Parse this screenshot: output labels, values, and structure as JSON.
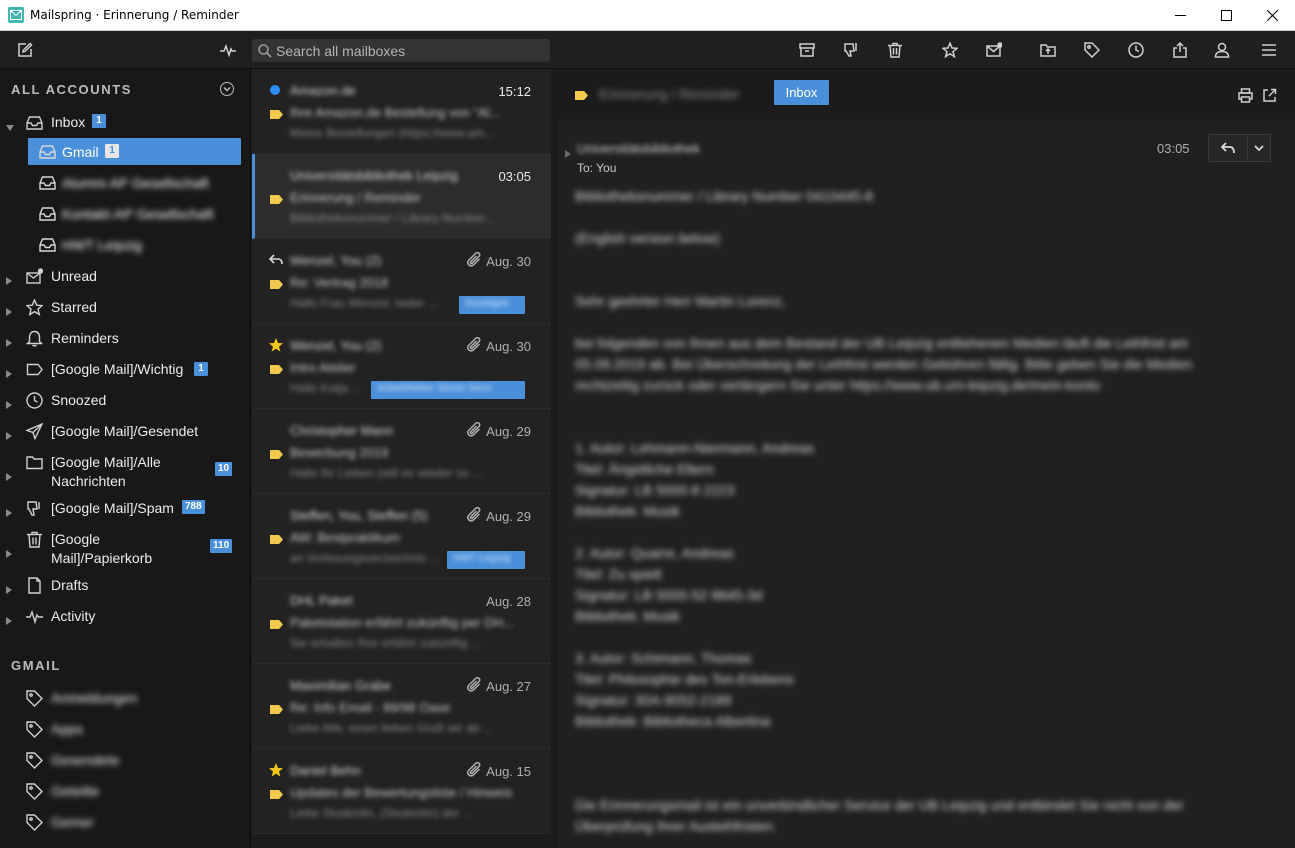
{
  "window": {
    "title": "Mailspring · Erinnerung / Reminder"
  },
  "toolbar": {
    "search_placeholder": "Search all mailboxes",
    "left_icons": [
      "compose-icon",
      "activity-icon"
    ],
    "right_icons": [
      "archive-icon",
      "spam-icon",
      "trash-icon",
      "star-icon",
      "mark-unread-icon",
      "move-folder-icon",
      "label-icon",
      "snooze-icon",
      "share-icon",
      "account-icon",
      "menu-icon"
    ]
  },
  "sidebar": {
    "all_accounts_header": "ALL ACCOUNTS",
    "gmail_header": "GMAIL",
    "inbox": {
      "label": "Inbox",
      "badge": "1"
    },
    "accounts": [
      {
        "label": "Gmail",
        "badge": "1",
        "selected": true
      },
      {
        "label": "Alumni-AP Gesellschaft",
        "blurred": true
      },
      {
        "label": "Kontakt-AP Gesellschaft",
        "blurred": true
      },
      {
        "label": "HWT Leipzig",
        "blurred": true
      }
    ],
    "items": [
      {
        "label": "Unread",
        "icon": "unread-icon",
        "badge": ""
      },
      {
        "label": "Starred",
        "icon": "star-icon",
        "badge": ""
      },
      {
        "label": "Reminders",
        "icon": "bell-icon",
        "badge": ""
      },
      {
        "label": "[Google Mail]/Wichtig",
        "icon": "label-icon",
        "badge": "1"
      },
      {
        "label": "Snoozed",
        "icon": "clock-icon",
        "badge": ""
      },
      {
        "label": "[Google Mail]/Gesendet",
        "icon": "send-icon",
        "badge": ""
      },
      {
        "label": "[Google Mail]/Alle Nachrichten",
        "icon": "folder-icon",
        "badge": "10"
      },
      {
        "label": "[Google Mail]/Spam",
        "icon": "spam-icon",
        "badge": "788"
      },
      {
        "label": "[Google Mail]/Papierkorb",
        "icon": "trash-icon",
        "badge": "110"
      },
      {
        "label": "Drafts",
        "icon": "drafts-icon",
        "badge": ""
      },
      {
        "label": "Activity",
        "icon": "activity-icon",
        "badge": ""
      }
    ],
    "gmail_labels": [
      "Anmeldungen",
      "Apps",
      "Gesendete",
      "Geteilte",
      "Gemer"
    ]
  },
  "messages": [
    {
      "from": "Amazon.de",
      "subject": "Ihre Amazon.de Bestellung von \"Al...",
      "snippet": "Meine Bestellungen (https://www.am...",
      "date": "15:12",
      "unread": true,
      "starred": false,
      "replied": false,
      "attachment": false,
      "label": ""
    },
    {
      "from": "Universitätsbibliothek Leipzig",
      "subject": "Erinnerung / Reminder",
      "snippet": "Bibliotheksnummer / Library Number...",
      "date": "03:05",
      "unread": false,
      "starred": false,
      "replied": false,
      "attachment": false,
      "label": "",
      "selected": true
    },
    {
      "from": "Wenzel, You (2)",
      "subject": "Re: Vertrag 2018",
      "snippet": "Hallo Frau Wenzel, leider ...",
      "date": "Aug. 30",
      "unread": false,
      "starred": false,
      "replied": true,
      "attachment": true,
      "label": "Sonstiges"
    },
    {
      "from": "Wenzel, You (2)",
      "subject": "Intro Atelier",
      "snippet": "Hallo Katja ...",
      "date": "Aug. 30",
      "unread": false,
      "starred": true,
      "replied": false,
      "attachment": true,
      "label": "Arbeit/Atelier Simon Senn"
    },
    {
      "from": "Christopher Mann",
      "subject": "Bewerbung 2019",
      "snippet": "Hallo Ihr Lieben (will es wieder so ...",
      "date": "Aug. 29",
      "unread": false,
      "starred": false,
      "replied": false,
      "attachment": true,
      "label": ""
    },
    {
      "from": "Steffen, You, Steffen (5)",
      "subject": "AW: Bestpraktikum",
      "snippet": "an Vorlesungsverzeichnis ...",
      "date": "Aug. 29",
      "unread": false,
      "starred": false,
      "replied": false,
      "attachment": true,
      "label": "HWT Leipzig"
    },
    {
      "from": "DHL Paket",
      "subject": "Paketstation erfährt zukünftig per DH...",
      "snippet": "Sie erhalten Ihre erfährt zukünftig ...",
      "date": "Aug. 28",
      "unread": false,
      "starred": false,
      "replied": false,
      "attachment": false,
      "label": ""
    },
    {
      "from": "Maximilian Grabe",
      "subject": "Re: Info Email - 89/98 Oase",
      "snippet": "Liebe Alle, einen lieben Gruß wir ab ...",
      "date": "Aug. 27",
      "unread": false,
      "starred": false,
      "replied": false,
      "attachment": true,
      "label": ""
    },
    {
      "from": "Daniel Behn",
      "subject": "Updates der Bewertungsliste / Hinweis",
      "snippet": "Liebe Studentin, (Studentin) der ...",
      "date": "Aug. 15",
      "unread": false,
      "starred": true,
      "replied": false,
      "attachment": true,
      "label": ""
    }
  ],
  "reader": {
    "subject": "Erinnerung / Reminder",
    "folder_chip": "Inbox",
    "sender": "Universitätsbibliothek",
    "to": "To: You",
    "time": "03:05",
    "body": [
      "Bibliotheksnummer / Library Number 0410445-8",
      "",
      "(English version below)",
      "",
      "",
      "Sehr geehrter Herr Martin Lorenz,",
      "",
      "bei folgenden von Ihnen aus dem Bestand der UB Leipzig entliehenen Medien läuft die Leihfrist am",
      "05.09.2019 ab. Bei Überschreitung der Leihfrist werden Gebühren fällig. Bitte geben Sie die Medien",
      "rechtzeitig zurück oder verlängern Sie unter https://www.ub.uni-leipzig.de/mein-konto",
      "",
      "",
      "1. Autor: Lehmann-Niermann, Andreas",
      "Titel: Ängstliche Eltern",
      "Signatur: LB 5000-8 2223",
      "Bibliothek: Musik",
      "",
      "2. Autor: Quarre, Andreas",
      "Titel: Zu spielt",
      "Signatur: LB 5000-52 8845-3d",
      "Bibliothek: Musik",
      "",
      "3. Autor: Schimann, Thomas",
      "Titel: Philosophie des Ton-Erlebens",
      "Signatur: 30A-9052-2189",
      "Bibliothek: Bibliotheca Albertina",
      "",
      "",
      "",
      "",
      "Die Erinnerungsmail ist ein unverbindlicher Service der UB Leipzig und entbindet Sie nicht von der",
      "Überprüfung Ihrer Ausleihfristen."
    ]
  },
  "colors": {
    "accent": "#4a8fd9",
    "tag_yellow": "#f2c94c",
    "unread_dot": "#2f8bf0",
    "star": "#f5c518"
  }
}
